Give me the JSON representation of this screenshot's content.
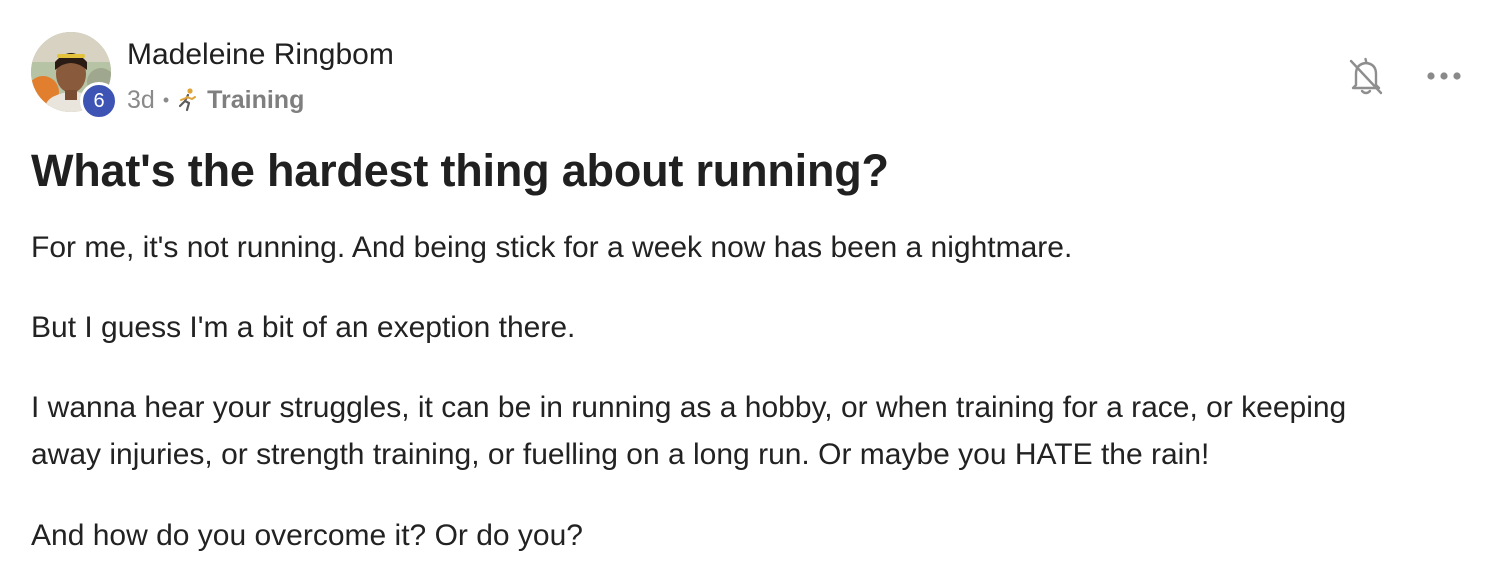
{
  "author": {
    "name": "Madeleine Ringbom",
    "level": "6",
    "time_ago": "3d",
    "separator": "•",
    "category": "Training",
    "category_icon": "running-person-icon"
  },
  "actions": {
    "bell_icon": "bell-off-icon",
    "more_icon": "more-horizontal-icon"
  },
  "post": {
    "title": "What's the hardest thing about running?",
    "paragraphs": [
      [
        "For me, it's not running. And being stick for a week now has been a nightmare."
      ],
      [
        "But I guess I'm a bit of an exeption there."
      ],
      [
        "I wanna hear your struggles, it can be in running as a hobby, or when training for a race, or keeping",
        "away injuries, or strength training, or fuelling on a long run. Or maybe you HATE the rain!"
      ],
      [
        "And how do you overcome it? Or do you?"
      ]
    ]
  },
  "colors": {
    "badge": "#3e54b5",
    "text": "#202020",
    "muted": "#8a8a8a"
  }
}
